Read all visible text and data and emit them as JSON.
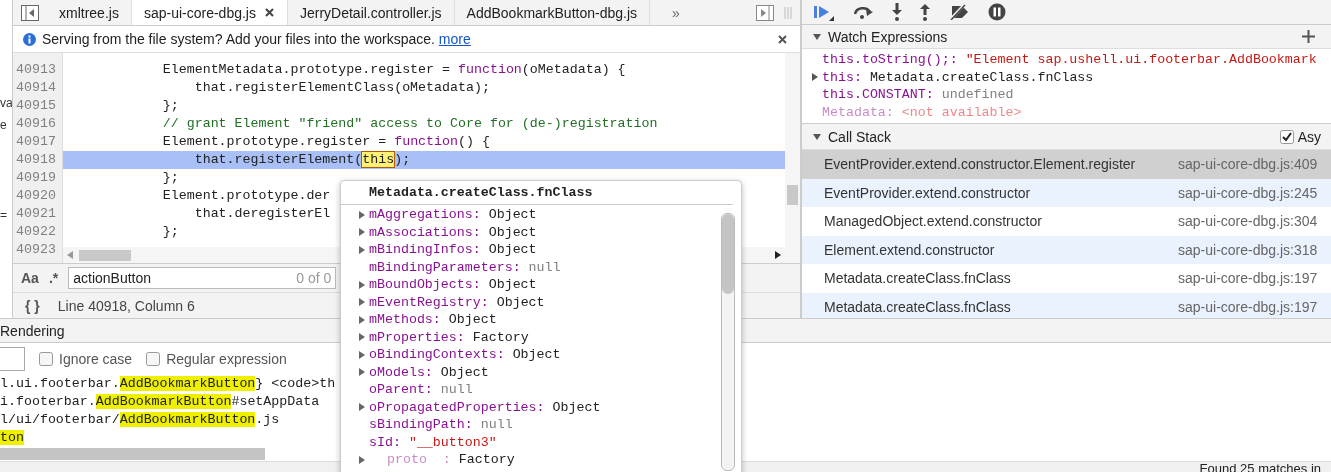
{
  "editor_tabs": [
    {
      "label": "xmltree.js",
      "selected": false,
      "closable": false
    },
    {
      "label": "sap-ui-core-dbg.js",
      "selected": true,
      "closable": true
    },
    {
      "label": "JerryDetail.controller.js",
      "selected": false,
      "closable": false
    },
    {
      "label": "AddBookmarkButton-dbg.js",
      "selected": false,
      "closable": false
    }
  ],
  "tab_overflow": "»",
  "side_fragments": [
    "va",
    "e",
    "="
  ],
  "info_bar": {
    "message": "Serving from the file system? Add your files into the workspace.",
    "link": "more"
  },
  "code": {
    "lines": [
      {
        "number": "40913",
        "current": false,
        "tokens": [
          {
            "text": "            ElementMetadata.prototype.register = ",
            "kind": "plain"
          },
          {
            "text": "function",
            "kind": "keyword"
          },
          {
            "text": "(oMetadata) {",
            "kind": "plain"
          }
        ]
      },
      {
        "number": "40914",
        "current": false,
        "tokens": [
          {
            "text": "                that.registerElementClass(oMetadata);",
            "kind": "plain"
          }
        ]
      },
      {
        "number": "40915",
        "current": false,
        "tokens": [
          {
            "text": "            };",
            "kind": "plain"
          }
        ]
      },
      {
        "number": "40916",
        "current": false,
        "tokens": [
          {
            "text": "            // grant Element \"friend\" access to Core for (de-)registration",
            "kind": "comment"
          }
        ]
      },
      {
        "number": "40917",
        "current": false,
        "tokens": [
          {
            "text": "            Element.prototype.register = ",
            "kind": "plain"
          },
          {
            "text": "function",
            "kind": "keyword"
          },
          {
            "text": "() {",
            "kind": "plain"
          }
        ]
      },
      {
        "number": "40918",
        "current": true,
        "tokens": [
          {
            "text": "                that.registerElement(",
            "kind": "plain"
          },
          {
            "text": "this",
            "kind": "match"
          },
          {
            "text": ");",
            "kind": "plain"
          }
        ]
      },
      {
        "number": "40919",
        "current": false,
        "tokens": [
          {
            "text": "            };",
            "kind": "plain"
          }
        ]
      },
      {
        "number": "40920",
        "current": false,
        "tokens": [
          {
            "text": "            Element.prototype.der",
            "kind": "plain"
          }
        ]
      },
      {
        "number": "40921",
        "current": false,
        "tokens": [
          {
            "text": "                that.deregisterEl",
            "kind": "plain"
          }
        ]
      },
      {
        "number": "40922",
        "current": false,
        "tokens": [
          {
            "text": "            };",
            "kind": "plain"
          }
        ]
      },
      {
        "number": "40923",
        "current": false
      }
    ]
  },
  "search": {
    "case_toggle": "Aa",
    "regex_toggle": ".*",
    "value": "actionButton",
    "count": "0 of 0"
  },
  "status": {
    "pretty_print": "{ }",
    "position": "Line 40918, Column 6"
  },
  "debugger": {
    "watch": {
      "title": "Watch Expressions",
      "expanded": true,
      "items": [
        {
          "name": "this.toString();:",
          "value": "\"Element sap.ushell.ui.footerbar.AddBookmark",
          "kind": "string",
          "expandable": false
        },
        {
          "name": "this:",
          "value": "Metadata.createClass.fnClass",
          "kind": "object",
          "expandable": true
        },
        {
          "name": "this.CONSTANT:",
          "value": "undefined",
          "kind": "empty",
          "expandable": false
        },
        {
          "name": "Metadata:",
          "value": "<not available>",
          "kind": "unavailable",
          "expandable": false
        }
      ]
    },
    "call_stack": {
      "title": "Call Stack",
      "expanded": true,
      "async": {
        "label": "Asy",
        "checked": true
      },
      "frames": [
        {
          "function": "EventProvider.extend.constructor.Element.register",
          "location": "sap-ui-core-dbg.js:409",
          "selected": true
        },
        {
          "function": "EventProvider.extend.constructor",
          "location": "sap-ui-core-dbg.js:245",
          "selected": false
        },
        {
          "function": "ManagedObject.extend.constructor",
          "location": "sap-ui-core-dbg.js:304",
          "selected": false
        },
        {
          "function": "Element.extend.constructor",
          "location": "sap-ui-core-dbg.js:318",
          "selected": false
        },
        {
          "function": "Metadata.createClass.fnClass",
          "location": "sap-ui-core-dbg.js:197",
          "selected": false
        },
        {
          "function": "Metadata.createClass.fnClass",
          "location": "sap-ui-core-dbg.js:197",
          "selected": false
        }
      ]
    }
  },
  "drawer": {
    "tab": "Rendering",
    "ignore_case": {
      "label": "Ignore case",
      "checked": false
    },
    "regex": {
      "label": "Regular expression",
      "checked": false
    },
    "results": [
      {
        "segments": [
          {
            "text": "l.ui.footerbar.",
            "match": false
          },
          {
            "text": "AddBookmarkButton",
            "match": true
          },
          {
            "text": "} <code>th",
            "match": false
          }
        ]
      },
      {
        "segments": [
          {
            "text": "i.footerbar.",
            "match": false
          },
          {
            "text": "AddBookmarkButton",
            "match": true
          },
          {
            "text": "#setAppData",
            "match": false
          }
        ]
      },
      {
        "segments": [
          {
            "text": "l/ui/footerbar/",
            "match": false
          },
          {
            "text": "AddBookmarkButton",
            "match": true
          },
          {
            "text": ".js",
            "match": false
          }
        ]
      },
      {
        "segments": [
          {
            "text": "ton",
            "match": true
          }
        ]
      }
    ],
    "summary": "Found 25 matches in"
  },
  "popup": {
    "title": "Metadata.createClass.fnClass",
    "properties": [
      {
        "name": "mAggregations:",
        "value": "Object",
        "kind": "object",
        "expandable": true
      },
      {
        "name": "mAssociations:",
        "value": "Object",
        "kind": "object",
        "expandable": true
      },
      {
        "name": "mBindingInfos:",
        "value": "Object",
        "kind": "object",
        "expandable": true
      },
      {
        "name": "mBindingParameters:",
        "value": "null",
        "kind": "empty",
        "expandable": false
      },
      {
        "name": "mBoundObjects:",
        "value": "Object",
        "kind": "object",
        "expandable": true
      },
      {
        "name": "mEventRegistry:",
        "value": "Object",
        "kind": "object",
        "expandable": true
      },
      {
        "name": "mMethods:",
        "value": "Object",
        "kind": "object",
        "expandable": true
      },
      {
        "name": "mProperties:",
        "value": "Factory",
        "kind": "object",
        "expandable": true
      },
      {
        "name": "oBindingContexts:",
        "value": "Object",
        "kind": "object",
        "expandable": true
      },
      {
        "name": "oModels:",
        "value": "Object",
        "kind": "object",
        "expandable": true
      },
      {
        "name": "oParent:",
        "value": "null",
        "kind": "empty",
        "expandable": false
      },
      {
        "name": "oPropagatedProperties:",
        "value": "Object",
        "kind": "object",
        "expandable": true
      },
      {
        "name": "sBindingPath:",
        "value": "null",
        "kind": "empty",
        "expandable": false
      },
      {
        "name": "sId:",
        "value": "\"__button3\"",
        "kind": "string",
        "expandable": false
      },
      {
        "name": "proto  :",
        "value": "Factory",
        "kind": "internal",
        "expandable": true
      }
    ]
  }
}
